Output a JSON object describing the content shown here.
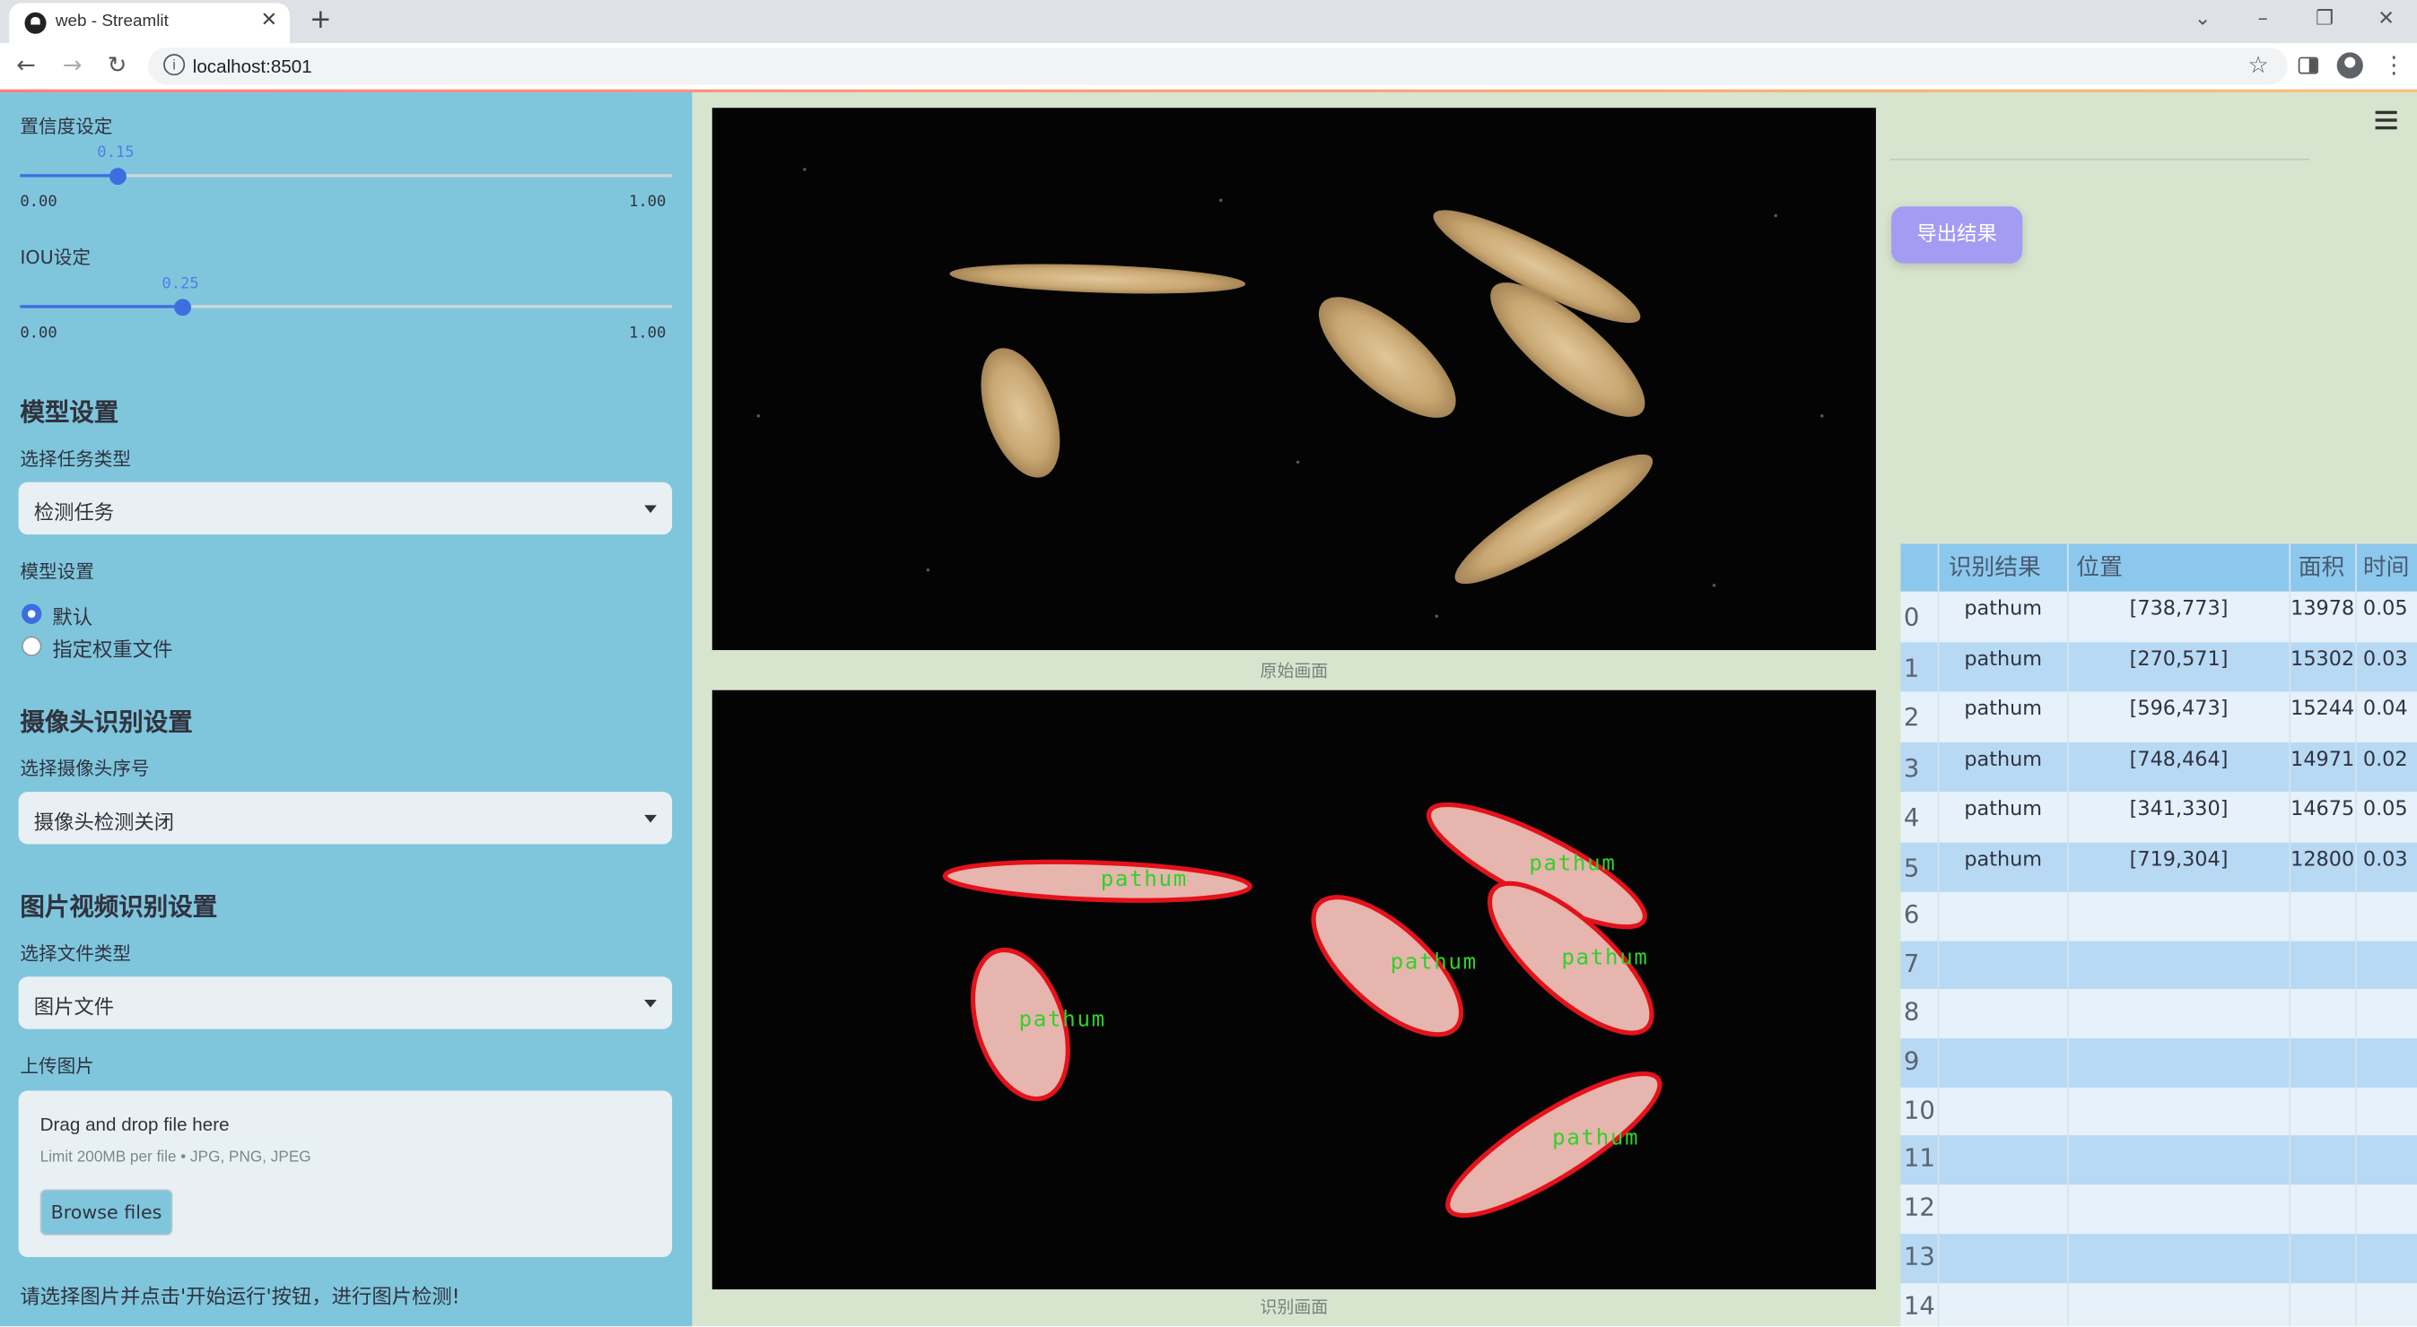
{
  "browser": {
    "tab_title": "web - Streamlit",
    "url": "localhost:8501"
  },
  "sidebar": {
    "confidence": {
      "label": "置信度设定",
      "value": "0.15",
      "min": "0.00",
      "max": "1.00",
      "fraction": 0.15
    },
    "iou": {
      "label": "IOU设定",
      "value": "0.25",
      "min": "0.00",
      "max": "1.00",
      "fraction": 0.25
    },
    "model_section": "模型设置",
    "task_label": "选择任务类型",
    "task_value": "检测任务",
    "model_label": "模型设置",
    "model_options": [
      "默认",
      "指定权重文件"
    ],
    "camera_section": "摄像头识别设置",
    "camera_label": "选择摄像头序号",
    "camera_value": "摄像头检测关闭",
    "media_section": "图片视频识别设置",
    "filetype_label": "选择文件类型",
    "filetype_value": "图片文件",
    "upload_label": "上传图片",
    "drop_text": "Drag and drop file here",
    "limit_text": "Limit 200MB per file • JPG, PNG, JPEG",
    "browse_label": "Browse files",
    "hint": "请选择图片并点击'开始运行'按钮，进行图片检测!"
  },
  "main": {
    "original_caption": "原始画面",
    "result_caption": "识别画面",
    "detection_label": "pathum",
    "export_label": "导出结果"
  },
  "table": {
    "headers": [
      "",
      "识别结果",
      "位置",
      "面积",
      "时间"
    ],
    "rows": [
      [
        "0",
        "pathum",
        "[738,773]",
        "13978",
        "0.05"
      ],
      [
        "1",
        "pathum",
        "[270,571]",
        "15302",
        "0.03"
      ],
      [
        "2",
        "pathum",
        "[596,473]",
        "15244",
        "0.04"
      ],
      [
        "3",
        "pathum",
        "[748,464]",
        "14971",
        "0.02"
      ],
      [
        "4",
        "pathum",
        "[341,330]",
        "14675",
        "0.05"
      ],
      [
        "5",
        "pathum",
        "[719,304]",
        "12800",
        "0.03"
      ]
    ],
    "empty_indices": [
      "6",
      "7",
      "8",
      "9",
      "10",
      "11",
      "12",
      "13",
      "14"
    ]
  }
}
